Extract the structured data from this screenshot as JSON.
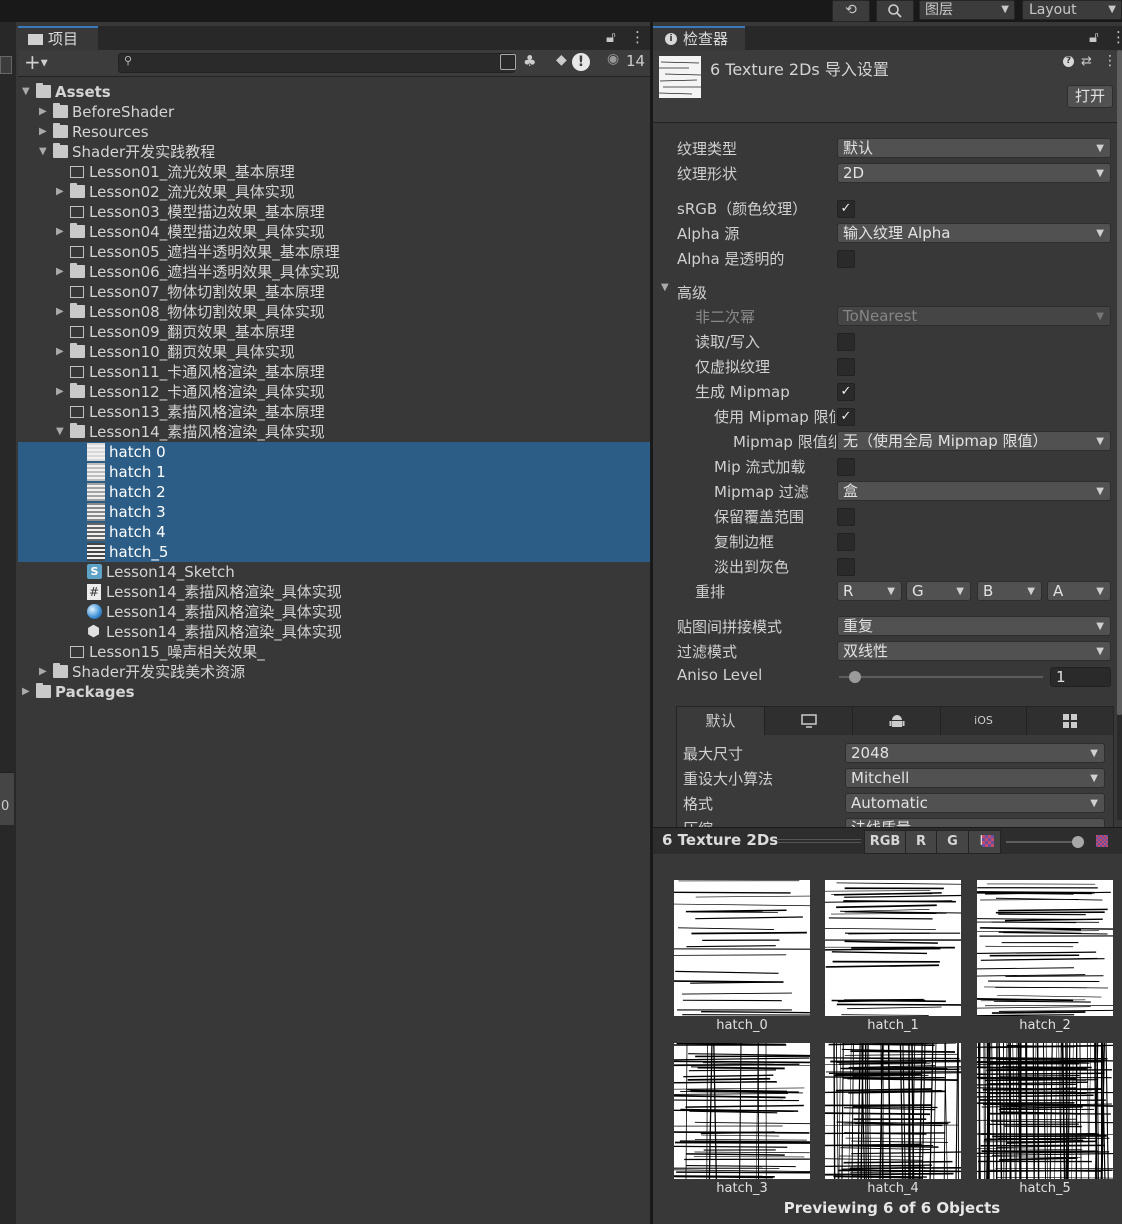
{
  "toolbar": {
    "layers_label": "图层",
    "layout_label": "Layout"
  },
  "project": {
    "tab_label": "项目",
    "eye_count": "14",
    "search_placeholder": "",
    "tree": [
      {
        "label": "Assets",
        "depth": 0,
        "kind": "folder",
        "fold": "open",
        "bold": true
      },
      {
        "label": "BeforeShader",
        "depth": 1,
        "kind": "folder",
        "fold": "closed"
      },
      {
        "label": "Resources",
        "depth": 1,
        "kind": "folder",
        "fold": "closed"
      },
      {
        "label": "Shader开发实践教程",
        "depth": 1,
        "kind": "folder",
        "fold": "open"
      },
      {
        "label": "Lesson01_流光效果_基本原理",
        "depth": 2,
        "kind": "empty-folder",
        "fold": "none"
      },
      {
        "label": "Lesson02_流光效果_具体实现",
        "depth": 2,
        "kind": "folder",
        "fold": "closed"
      },
      {
        "label": "Lesson03_模型描边效果_基本原理",
        "depth": 2,
        "kind": "empty-folder",
        "fold": "none"
      },
      {
        "label": "Lesson04_模型描边效果_具体实现",
        "depth": 2,
        "kind": "folder",
        "fold": "closed"
      },
      {
        "label": "Lesson05_遮挡半透明效果_基本原理",
        "depth": 2,
        "kind": "empty-folder",
        "fold": "none"
      },
      {
        "label": "Lesson06_遮挡半透明效果_具体实现",
        "depth": 2,
        "kind": "folder",
        "fold": "closed"
      },
      {
        "label": "Lesson07_物体切割效果_基本原理",
        "depth": 2,
        "kind": "empty-folder",
        "fold": "none"
      },
      {
        "label": "Lesson08_物体切割效果_具体实现",
        "depth": 2,
        "kind": "folder",
        "fold": "closed"
      },
      {
        "label": "Lesson09_翻页效果_基本原理",
        "depth": 2,
        "kind": "empty-folder",
        "fold": "none"
      },
      {
        "label": "Lesson10_翻页效果_具体实现",
        "depth": 2,
        "kind": "folder",
        "fold": "closed"
      },
      {
        "label": "Lesson11_卡通风格渲染_基本原理",
        "depth": 2,
        "kind": "empty-folder",
        "fold": "none"
      },
      {
        "label": "Lesson12_卡通风格渲染_具体实现",
        "depth": 2,
        "kind": "folder",
        "fold": "closed"
      },
      {
        "label": "Lesson13_素描风格渲染_基本原理",
        "depth": 2,
        "kind": "empty-folder",
        "fold": "none"
      },
      {
        "label": "Lesson14_素描风格渲染_具体实现",
        "depth": 2,
        "kind": "folder",
        "fold": "open"
      },
      {
        "label": "hatch 0",
        "depth": 3,
        "kind": "texture",
        "fold": "none",
        "selected": true,
        "shade": "#d8d8d8"
      },
      {
        "label": "hatch 1",
        "depth": 3,
        "kind": "texture",
        "fold": "none",
        "selected": true,
        "shade": "#bdbdbd"
      },
      {
        "label": "hatch 2",
        "depth": 3,
        "kind": "texture",
        "fold": "none",
        "selected": true,
        "shade": "#a3a3a3"
      },
      {
        "label": "hatch 3",
        "depth": 3,
        "kind": "texture",
        "fold": "none",
        "selected": true,
        "shade": "#8a8a8a"
      },
      {
        "label": "hatch 4",
        "depth": 3,
        "kind": "texture",
        "fold": "none",
        "selected": true,
        "shade": "#666666"
      },
      {
        "label": "hatch_5",
        "depth": 3,
        "kind": "texture",
        "fold": "none",
        "selected": true,
        "shade": "#444444"
      },
      {
        "label": "Lesson14_Sketch",
        "depth": 3,
        "kind": "shader",
        "fold": "none"
      },
      {
        "label": "Lesson14_素描风格渲染_具体实现",
        "depth": 3,
        "kind": "script",
        "fold": "none"
      },
      {
        "label": "Lesson14_素描风格渲染_具体实现",
        "depth": 3,
        "kind": "material",
        "fold": "none"
      },
      {
        "label": "Lesson14_素描风格渲染_具体实现",
        "depth": 3,
        "kind": "scene",
        "fold": "none"
      },
      {
        "label": "Lesson15_噪声相关效果_",
        "depth": 2,
        "kind": "empty-folder",
        "fold": "none"
      },
      {
        "label": "Shader开发实践美术资源",
        "depth": 1,
        "kind": "folder",
        "fold": "closed"
      },
      {
        "label": "Packages",
        "depth": 0,
        "kind": "folder",
        "fold": "closed",
        "bold": true
      }
    ]
  },
  "inspector": {
    "tab_label": "检查器",
    "title": "6 Texture 2Ds 导入设置",
    "open_button": "打开",
    "fields": {
      "texture_type": {
        "label": "纹理类型",
        "value": "默认"
      },
      "texture_shape": {
        "label": "纹理形状",
        "value": "2D"
      },
      "srgb": {
        "label": "sRGB（颜色纹理）",
        "checked": true
      },
      "alpha_source": {
        "label": "Alpha 源",
        "value": "输入纹理 Alpha"
      },
      "alpha_transparency": {
        "label": "Alpha 是透明的",
        "checked": false
      },
      "advanced": {
        "label": "高级"
      },
      "non_power_of_2": {
        "label": "非二次幂",
        "value": "ToNearest"
      },
      "read_write": {
        "label": "读取/写入",
        "checked": false
      },
      "virtual_texture_only": {
        "label": "仅虚拟纹理",
        "checked": false
      },
      "generate_mipmap": {
        "label": "生成 Mipmap",
        "checked": true
      },
      "use_mipmap_limits": {
        "label": "使用 Mipmap 限值",
        "checked": true
      },
      "mipmap_limit_group": {
        "label": "Mipmap 限值组",
        "value": "无（使用全局 Mipmap 限值）"
      },
      "mip_streaming": {
        "label": "Mip 流式加载",
        "checked": false
      },
      "mipmap_filtering": {
        "label": "Mipmap 过滤",
        "value": "盒"
      },
      "preserve_coverage": {
        "label": "保留覆盖范围",
        "checked": false
      },
      "replicate_border": {
        "label": "复制边框",
        "checked": false
      },
      "fadeout_to_gray": {
        "label": "淡出到灰色",
        "checked": false
      },
      "swizzle": {
        "label": "重排",
        "r": "R",
        "g": "G",
        "b": "B",
        "a": "A"
      },
      "wrap_mode": {
        "label": "贴图间拼接模式",
        "value": "重复"
      },
      "filter_mode": {
        "label": "过滤模式",
        "value": "双线性"
      },
      "aniso_level": {
        "label": "Aniso Level",
        "value": "1",
        "fraction": 0.0
      }
    },
    "platform_tabs": {
      "default": "默认",
      "ios": "iOS",
      "icons": [
        "monitor-icon",
        "android-icon",
        "windows-icon"
      ]
    },
    "platform": {
      "max_size": {
        "label": "最大尺寸",
        "value": "2048"
      },
      "resize_algorithm": {
        "label": "重设大小算法",
        "value": "Mitchell"
      },
      "format": {
        "label": "格式",
        "value": "Automatic"
      },
      "compression": {
        "label": "压缩",
        "value": "法线质量"
      }
    }
  },
  "preview": {
    "title": "6 Texture 2Ds",
    "channels": [
      "RGB",
      "R",
      "G",
      "B"
    ],
    "footer": "Previewing 6 of 6 Objects",
    "tiles": [
      {
        "label": "hatch_0",
        "density": 0.15
      },
      {
        "label": "hatch_1",
        "density": 0.3
      },
      {
        "label": "hatch_2",
        "density": 0.45
      },
      {
        "label": "hatch_3",
        "density": 0.55
      },
      {
        "label": "hatch_4",
        "density": 0.7
      },
      {
        "label": "hatch_5",
        "density": 0.85
      }
    ]
  }
}
